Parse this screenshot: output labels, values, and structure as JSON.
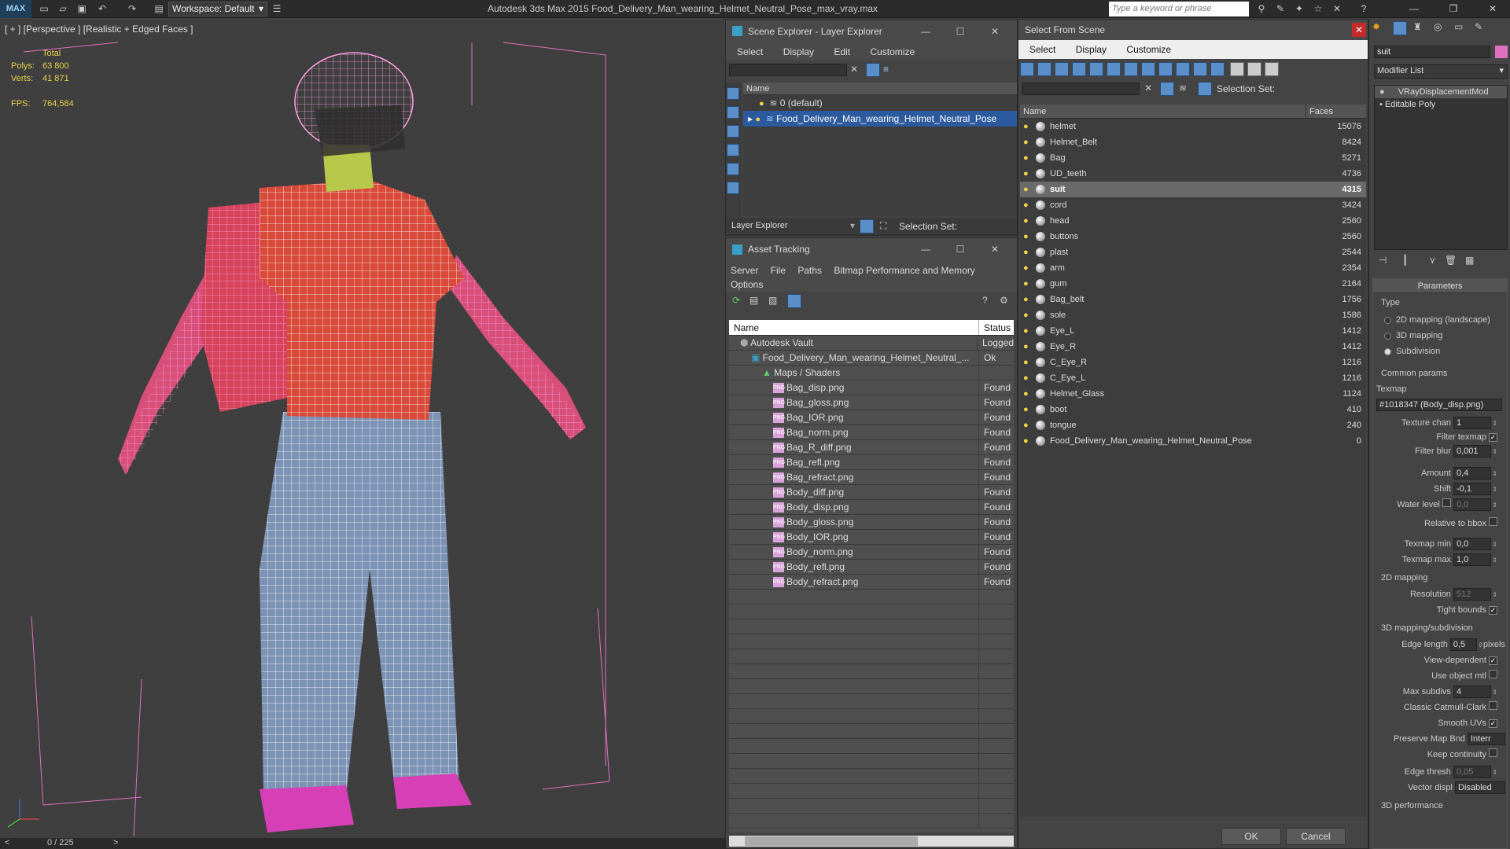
{
  "app": {
    "logo": "MAX",
    "workspace": "Workspace: Default",
    "title": "Autodesk 3ds Max  2015    Food_Delivery_Man_wearing_Helmet_Neutral_Pose_max_vray.max",
    "search_placeholder": "Type a keyword or phrase"
  },
  "viewport": {
    "label": "[ + ] [Perspective ] [Realistic + Edged Faces ]",
    "stats": {
      "total": "Total",
      "polys_k": "Polys:",
      "polys_v": "63 800",
      "verts_k": "Verts:",
      "verts_v": "41 871",
      "fps_k": "FPS:",
      "fps_v": "764,584"
    }
  },
  "timeline": {
    "frame": "0 / 225"
  },
  "scene_explorer": {
    "title": "Scene Explorer - Layer Explorer",
    "menu": [
      "Select",
      "Display",
      "Edit",
      "Customize"
    ],
    "col_name": "Name",
    "layers": [
      {
        "name": "0 (default)",
        "selected": false
      },
      {
        "name": "Food_Delivery_Man_wearing_Helmet_Neutral_Pose",
        "selected": true
      }
    ],
    "footer_dropdown": "Layer Explorer",
    "selection_set": "Selection Set:"
  },
  "asset_tracking": {
    "title": "Asset Tracking",
    "menu": [
      "Server",
      "File",
      "Paths",
      "Bitmap Performance and Memory"
    ],
    "menu2": "Options",
    "col_name": "Name",
    "col_status": "Status",
    "rows": [
      {
        "name": "Autodesk Vault",
        "status": "Logged",
        "indent": 1,
        "kind": "vault"
      },
      {
        "name": "Food_Delivery_Man_wearing_Helmet_Neutral_...",
        "status": "Ok",
        "indent": 2,
        "kind": "file"
      },
      {
        "name": "Maps / Shaders",
        "status": "",
        "indent": 3,
        "kind": "folder"
      },
      {
        "name": "Bag_disp.png",
        "status": "Found",
        "indent": 4,
        "kind": "png"
      },
      {
        "name": "Bag_gloss.png",
        "status": "Found",
        "indent": 4,
        "kind": "png"
      },
      {
        "name": "Bag_IOR.png",
        "status": "Found",
        "indent": 4,
        "kind": "png"
      },
      {
        "name": "Bag_norm.png",
        "status": "Found",
        "indent": 4,
        "kind": "png"
      },
      {
        "name": "Bag_R_diff.png",
        "status": "Found",
        "indent": 4,
        "kind": "png"
      },
      {
        "name": "Bag_refl.png",
        "status": "Found",
        "indent": 4,
        "kind": "png"
      },
      {
        "name": "Bag_refract.png",
        "status": "Found",
        "indent": 4,
        "kind": "png"
      },
      {
        "name": "Body_diff.png",
        "status": "Found",
        "indent": 4,
        "kind": "png"
      },
      {
        "name": "Body_disp.png",
        "status": "Found",
        "indent": 4,
        "kind": "png"
      },
      {
        "name": "Body_gloss.png",
        "status": "Found",
        "indent": 4,
        "kind": "png"
      },
      {
        "name": "Body_IOR.png",
        "status": "Found",
        "indent": 4,
        "kind": "png"
      },
      {
        "name": "Body_norm.png",
        "status": "Found",
        "indent": 4,
        "kind": "png"
      },
      {
        "name": "Body_refl.png",
        "status": "Found",
        "indent": 4,
        "kind": "png"
      },
      {
        "name": "Body_refract.png",
        "status": "Found",
        "indent": 4,
        "kind": "png"
      }
    ]
  },
  "select_from_scene": {
    "title": "Select From Scene",
    "menu": [
      "Select",
      "Display",
      "Customize"
    ],
    "selection_set": "Selection Set:",
    "col_name": "Name",
    "col_faces": "Faces",
    "rows": [
      {
        "name": "helmet",
        "faces": "15076"
      },
      {
        "name": "Helmet_Belt",
        "faces": "8424"
      },
      {
        "name": "Bag",
        "faces": "5271"
      },
      {
        "name": "UD_teeth",
        "faces": "4736"
      },
      {
        "name": "suit",
        "faces": "4315",
        "selected": true
      },
      {
        "name": "cord",
        "faces": "3424"
      },
      {
        "name": "head",
        "faces": "2560"
      },
      {
        "name": "buttons",
        "faces": "2560"
      },
      {
        "name": "plast",
        "faces": "2544"
      },
      {
        "name": "arm",
        "faces": "2354"
      },
      {
        "name": "gum",
        "faces": "2164"
      },
      {
        "name": "Bag_belt",
        "faces": "1756"
      },
      {
        "name": "sole",
        "faces": "1586"
      },
      {
        "name": "Eye_L",
        "faces": "1412"
      },
      {
        "name": "Eye_R",
        "faces": "1412"
      },
      {
        "name": "C_Eye_R",
        "faces": "1216"
      },
      {
        "name": "C_Eye_L",
        "faces": "1216"
      },
      {
        "name": "Helmet_Glass",
        "faces": "1124"
      },
      {
        "name": "boot",
        "faces": "410"
      },
      {
        "name": "tongue",
        "faces": "240"
      },
      {
        "name": "Food_Delivery_Man_wearing_Helmet_Neutral_Pose",
        "faces": "0"
      }
    ],
    "ok": "OK",
    "cancel": "Cancel"
  },
  "modifier": {
    "object_name": "suit",
    "list_label": "Modifier List",
    "stack": [
      "VRayDisplacementMod",
      "Editable Poly"
    ],
    "params_title": "Parameters",
    "type_label": "Type",
    "types": [
      {
        "label": "2D mapping (landscape)",
        "on": false
      },
      {
        "label": "3D mapping",
        "on": false
      },
      {
        "label": "Subdivision",
        "on": true
      }
    ],
    "common_label": "Common params",
    "texmap_label": "Texmap",
    "texmap_value": "#1018347 (Body_disp.png)",
    "texture_chan_k": "Texture chan",
    "texture_chan_v": "1",
    "filter_texmap": "Filter texmap",
    "filter_blur_k": "Filter blur",
    "filter_blur_v": "0,001",
    "amount_k": "Amount",
    "amount_v": "0,4",
    "shift_k": "Shift",
    "shift_v": "-0,1",
    "water_k": "Water level",
    "water_v": "0,0",
    "relative_bbox": "Relative to bbox",
    "texmap_min_k": "Texmap min",
    "texmap_min_v": "0,0",
    "texmap_max_k": "Texmap max",
    "texmap_max_v": "1,0",
    "mapping2d_label": "2D mapping",
    "resolution_k": "Resolution",
    "resolution_v": "512",
    "tight_bounds": "Tight bounds",
    "mapping3d_label": "3D mapping/subdivision",
    "edge_len_k": "Edge length",
    "edge_len_v": "0,5",
    "pixels": "pixels",
    "view_dep": "View-dependent",
    "use_obj_mtl": "Use object mtl",
    "max_subdivs_k": "Max subdivs",
    "max_subdivs_v": "4",
    "catmull": "Classic Catmull-Clark",
    "smooth_uvs": "Smooth UVs",
    "preserve_k": "Preserve Map Bnd",
    "preserve_v": "Interr",
    "keep_cont": "Keep continuity",
    "edge_thresh_k": "Edge thresh",
    "edge_thresh_v": "0,05",
    "vector_k": "Vector displ",
    "vector_v": "Disabled",
    "perf_label": "3D performance"
  }
}
